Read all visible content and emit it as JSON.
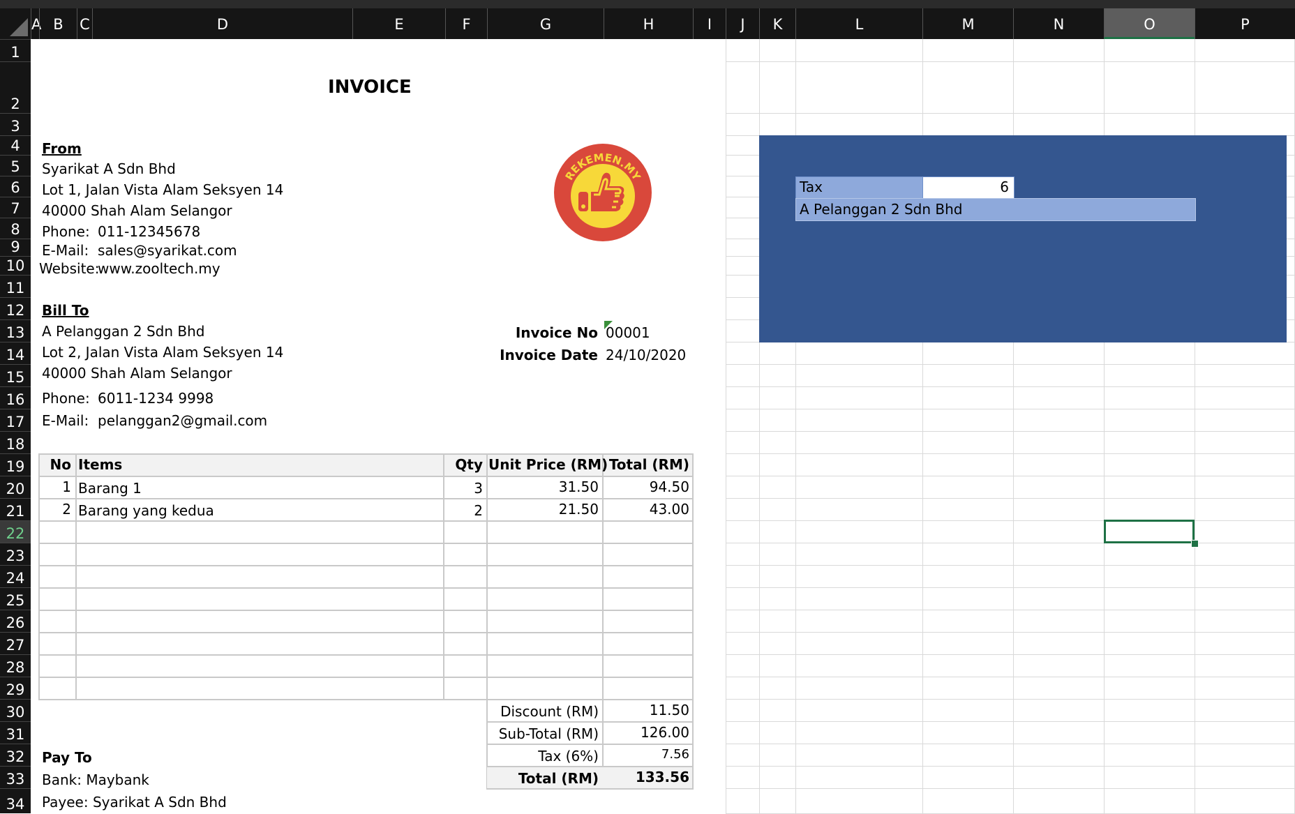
{
  "columns": [
    "A",
    "B",
    "C",
    "D",
    "E",
    "F",
    "G",
    "H",
    "I",
    "J",
    "K",
    "L",
    "M",
    "N",
    "O",
    "P"
  ],
  "rows": [
    "1",
    "2",
    "3",
    "4",
    "5",
    "6",
    "7",
    "8",
    "9",
    "10",
    "11",
    "12",
    "13",
    "14",
    "15",
    "16",
    "17",
    "18",
    "19",
    "20",
    "21",
    "22",
    "23",
    "24",
    "25",
    "26",
    "27",
    "28",
    "29",
    "30",
    "31",
    "32",
    "33",
    "34"
  ],
  "selected_column": "O",
  "selected_row": "22",
  "invoice": {
    "title": "INVOICE",
    "from_label": "From",
    "from_name": "Syarikat A Sdn Bhd",
    "from_addr1": "Lot 1, Jalan Vista Alam Seksyen 14",
    "from_addr2": "40000 Shah Alam Selangor",
    "phone_label": "Phone:",
    "from_phone": "011-12345678",
    "email_label": "E-Mail:",
    "from_email": "sales@syarikat.com",
    "website_label": "Website:",
    "from_website": "www.zooltech.my",
    "bill_to_label": "Bill To",
    "to_name": "A Pelanggan 2 Sdn Bhd",
    "to_addr1": "Lot 2, Jalan Vista Alam Seksyen 14",
    "to_addr2": "40000 Shah Alam Selangor",
    "to_phone": "6011-1234 9998",
    "to_email": "pelanggan2@gmail.com",
    "invoice_no_label": "Invoice No",
    "invoice_no": "00001",
    "invoice_date_label": "Invoice Date",
    "invoice_date": "24/10/2020",
    "logo_text": "REKEMEN.MY"
  },
  "table": {
    "headers": [
      "No",
      "Items",
      "Qty",
      "Unit Price (RM)",
      "Total (RM)"
    ],
    "items": [
      {
        "no": "1",
        "item": "Barang 1",
        "qty": "3",
        "unit": "31.50",
        "total": "94.50"
      },
      {
        "no": "2",
        "item": "Barang yang kedua",
        "qty": "2",
        "unit": "21.50",
        "total": "43.00"
      }
    ]
  },
  "summary": {
    "discount_label": "Discount (RM)",
    "discount": "11.50",
    "subtotal_label": "Sub-Total (RM)",
    "subtotal": "126.00",
    "tax_label": "Tax (6%)",
    "tax": "7.56",
    "total_label": "Total (RM)",
    "total": "133.56"
  },
  "payto": {
    "label": "Pay To",
    "bank": "Bank: Maybank",
    "payee": "Payee: Syarikat A Sdn Bhd"
  },
  "side_panel": {
    "tax_label": "Tax",
    "tax_value": "6",
    "customer": "A Pelanggan 2 Sdn Bhd"
  },
  "colors": {
    "panel_blue": "#34568f",
    "light_blue": "#8ea9db",
    "selection_green": "#1e7145",
    "logo_red": "#d9483b",
    "logo_yellow": "#f7d839"
  }
}
